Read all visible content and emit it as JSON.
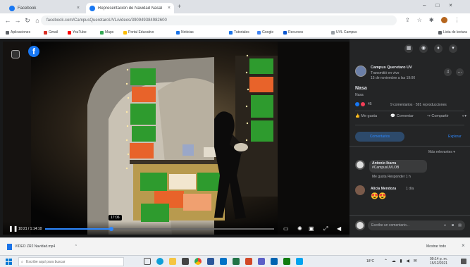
{
  "browser": {
    "tabs": [
      {
        "title": "Facebook",
        "active": false
      },
      {
        "title": "Representación de Navidad Nasal",
        "active": true
      }
    ],
    "new_tab": "+",
    "url": "facebook.com/CampusQueretaroUVL/videos/390949384982600",
    "bookmarks": [
      {
        "label": "Aplicaciones",
        "color": "#5f6368"
      },
      {
        "label": "Gmail",
        "color": "#d93025"
      },
      {
        "label": "YouTube",
        "color": "#ff0000"
      },
      {
        "label": "Maps",
        "color": "#34a853"
      },
      {
        "label": "Portal Educativo",
        "color": "#fbbc04"
      },
      {
        "label": "Noticias",
        "color": "#1a73e8"
      },
      {
        "label": "Tutoriales",
        "color": "#1a73e8"
      },
      {
        "label": "Google",
        "color": "#4285f4"
      },
      {
        "label": "Recursos",
        "color": "#0b57d0"
      },
      {
        "label": "UVL Campus",
        "color": "#9aa0a6"
      }
    ],
    "reading_list": "Lista de lectura"
  },
  "video": {
    "time_label": "10:21 / 1:14:10",
    "tooltip": "17:06",
    "progress_fraction": 0.29
  },
  "panel": {
    "page_name": "Campus Queretaro UV",
    "subtitle": "Transmitió en vivo",
    "date": "15 de noviembre a las 19:00",
    "post_title": "Nasa",
    "post_caption": "Nasa",
    "reaction_count": "45",
    "stats": "9 comentarios · 591 reproducciones",
    "actions": [
      "Me gusta",
      "Comentar",
      "Compartir"
    ],
    "tabs": [
      "Comentarios",
      "Explorar"
    ],
    "sort_label": "Más relevantes",
    "comments": [
      {
        "author": "Antonio Ibarra",
        "text": "#CampusUVLOB",
        "meta": "Me gusta  Responder  1 h"
      },
      {
        "author": "Alicia Mendoza",
        "text": "1 día",
        "meta": "😍😍"
      }
    ],
    "composer_placeholder": "Escribe un comentario..."
  },
  "download": {
    "filename": "VIDEO ZR2 Navidad.mp4",
    "show_all": "Mostrar todo"
  },
  "taskbar": {
    "search_placeholder": "Escribe aquí para buscar",
    "weather": "18°C",
    "time": "09:14 p. m.",
    "date": "15/12/2021"
  },
  "colors": {
    "panel_bg": "#242526",
    "accent": "#2d88ff",
    "facebook_blue": "#1877f2",
    "sign_green": "#2e9b2e",
    "sign_orange": "#e8632a"
  }
}
